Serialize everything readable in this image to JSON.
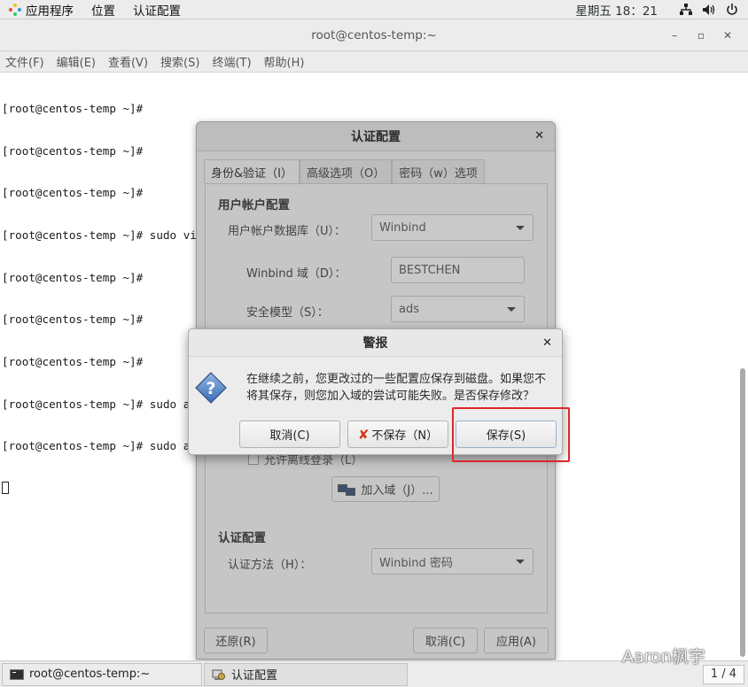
{
  "topbar": {
    "applications": "应用程序",
    "places": "位置",
    "active_app": "认证配置",
    "clock": "星期五 18：21"
  },
  "terminal": {
    "title": "root@centos-temp:~",
    "menu": [
      "文件(F)",
      "编辑(E)",
      "查看(V)",
      "搜索(S)",
      "终端(T)",
      "帮助(H)"
    ],
    "lines": [
      "[root@centos-temp ~]# ",
      "[root@centos-temp ~]# ",
      "[root@centos-temp ~]# ",
      "[root@centos-temp ~]# sudo vim /etc/samba/smb.conf",
      "[root@centos-temp ~]# ",
      "[root@centos-temp ~]# ",
      "[root@centos-temp ~]# ",
      "[root@centos-temp ~]# sudo a",
      "[root@centos-temp ~]# sudo a"
    ]
  },
  "auth_window": {
    "title": "认证配置",
    "tabs": [
      "身份&验证（I）",
      "高级选项（O）",
      "密码（w）选项"
    ],
    "user_account_config": "用户帐户配置",
    "user_db_label": "用户帐户数据库（U）：",
    "user_db_value": "Winbind",
    "winbind_domain_label": "Winbind 域（D）：",
    "winbind_domain_value": "BESTCHEN",
    "security_model_label": "安全模型（S）：",
    "security_model_value": "ads",
    "offline_login_label": "允许离线登录（L）",
    "join_domain_button": "加入域（J）...",
    "auth_config": "认证配置",
    "auth_method_label": "认证方法（H）：",
    "auth_method_value": "Winbind 密码",
    "revert_button": "还原(R)",
    "cancel_button": "取消(C)",
    "apply_button": "应用(A)"
  },
  "warning_dialog": {
    "title": "警报",
    "message_line1": "在继续之前，您更改过的一些配置应保存到磁盘。如果您不",
    "message_line2": "将其保存，则您加入域的尝试可能失败。是否保存修改？",
    "cancel_button": "取消(C)",
    "dont_save_button": "不保存（N）",
    "save_button": "保存(S)"
  },
  "taskbar": {
    "items": [
      "root@centos-temp:~",
      "认证配置"
    ],
    "workspace": "1 / 4"
  },
  "watermark": "Aaron枫宇",
  "colors": {
    "highlight_box": "#e0262a",
    "dim_overlay": "#c4c4c4"
  }
}
